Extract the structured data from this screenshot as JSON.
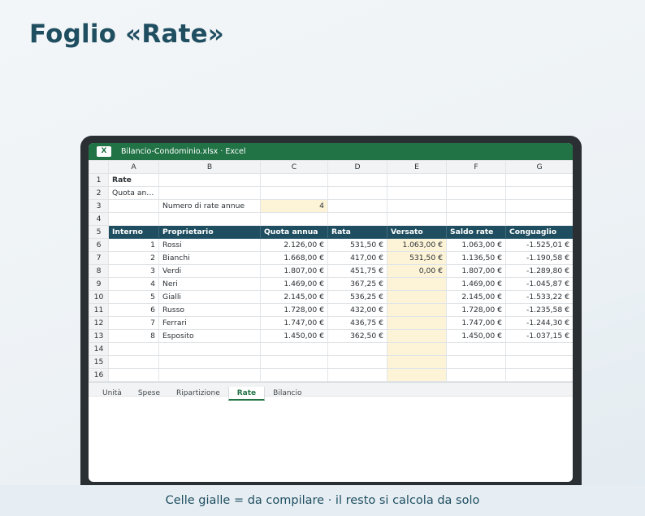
{
  "page_title": "Foglio «Rate»",
  "window": {
    "badge": "X",
    "title": "Bilancio-Condominio.xlsx · Excel"
  },
  "columns": [
    "A",
    "B",
    "C",
    "D",
    "E",
    "F",
    "G"
  ],
  "rows": {
    "r1": {
      "a": "Rate"
    },
    "r2": {
      "a": "Quota an…"
    },
    "r3": {
      "b": "Numero di rate annue",
      "c": "4"
    },
    "header": [
      "Interno",
      "Proprietario",
      "Quota annua",
      "Rata",
      "Versato",
      "Saldo rate",
      "Conguaglio"
    ],
    "data": [
      [
        "1",
        "Rossi",
        "2.126,00 €",
        "531,50 €",
        "1.063,00 €",
        "1.063,00 €",
        "-1.525,01 €"
      ],
      [
        "2",
        "Bianchi",
        "1.668,00 €",
        "417,00 €",
        "531,50 €",
        "1.136,50 €",
        "-1.190,58 €"
      ],
      [
        "3",
        "Verdi",
        "1.807,00 €",
        "451,75 €",
        "0,00 €",
        "1.807,00 €",
        "-1.289,80 €"
      ],
      [
        "4",
        "Neri",
        "1.469,00 €",
        "367,25 €",
        "",
        "1.469,00 €",
        "-1.045,87 €"
      ],
      [
        "5",
        "Gialli",
        "2.145,00 €",
        "536,25 €",
        "",
        "2.145,00 €",
        "-1.533,22 €"
      ],
      [
        "6",
        "Russo",
        "1.728,00 €",
        "432,00 €",
        "",
        "1.728,00 €",
        "-1.235,58 €"
      ],
      [
        "7",
        "Ferrari",
        "1.747,00 €",
        "436,75 €",
        "",
        "1.747,00 €",
        "-1.244,30 €"
      ],
      [
        "8",
        "Esposito",
        "1.450,00 €",
        "362,50 €",
        "",
        "1.450,00 €",
        "-1.037,15 €"
      ]
    ]
  },
  "row_numbers": [
    "1",
    "2",
    "3",
    "4",
    "5",
    "6",
    "7",
    "8",
    "9",
    "10",
    "11",
    "12",
    "13",
    "14",
    "15",
    "16"
  ],
  "sheet_tabs": [
    "Unità",
    "Spese",
    "Ripartizione",
    "Rate",
    "Bilancio"
  ],
  "active_tab": "Rate",
  "footer_note": "Celle gialle = da compilare · il resto si calcola da solo",
  "colors": {
    "excel_green": "#217346",
    "header_teal": "#1f4e60",
    "input_yellow": "#fdf4d8"
  }
}
